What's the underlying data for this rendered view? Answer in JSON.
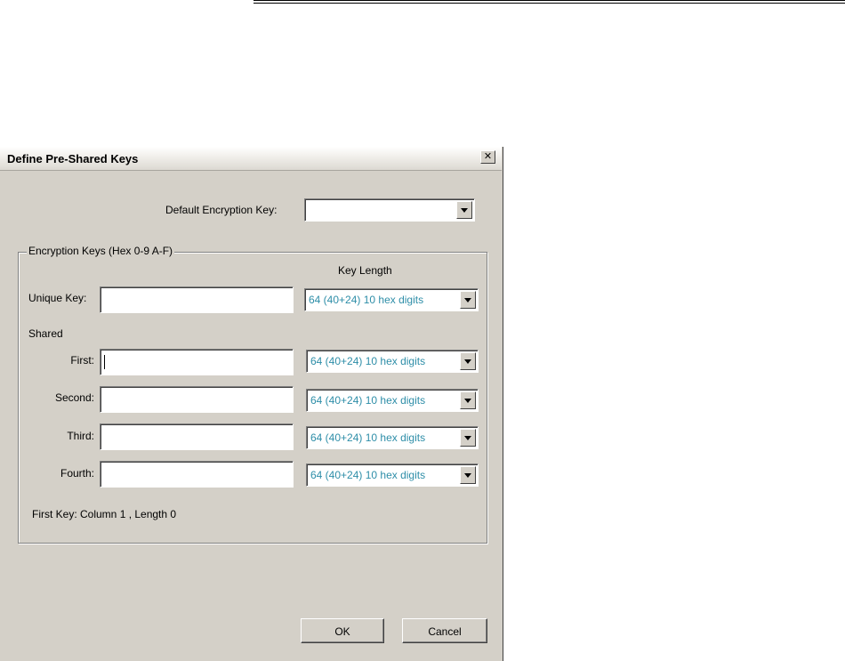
{
  "dialog": {
    "title": "Define Pre-Shared Keys",
    "close_glyph": "✕"
  },
  "default_key": {
    "label": "Default Encryption Key:",
    "value": ""
  },
  "group": {
    "legend": "Encryption Keys (Hex 0-9 A-F)",
    "key_length_header": "Key Length",
    "unique": {
      "label": "Unique Key:",
      "value": "",
      "length": "64  (40+24)  10 hex digits"
    },
    "shared_label": "Shared",
    "shared": [
      {
        "label": "First:",
        "value": "",
        "length": "64  (40+24)  10 hex digits"
      },
      {
        "label": "Second:",
        "value": "",
        "length": "64  (40+24)  10 hex digits"
      },
      {
        "label": "Third:",
        "value": "",
        "length": "64  (40+24)  10 hex digits"
      },
      {
        "label": "Fourth:",
        "value": "",
        "length": "64  (40+24)  10 hex digits"
      }
    ],
    "status": "First Key: Column 1 ,  Length 0"
  },
  "buttons": {
    "ok": "OK",
    "cancel": "Cancel"
  },
  "colors": {
    "dialog_bg": "#d4d0c8",
    "combo_text": "#2e8ea8"
  }
}
